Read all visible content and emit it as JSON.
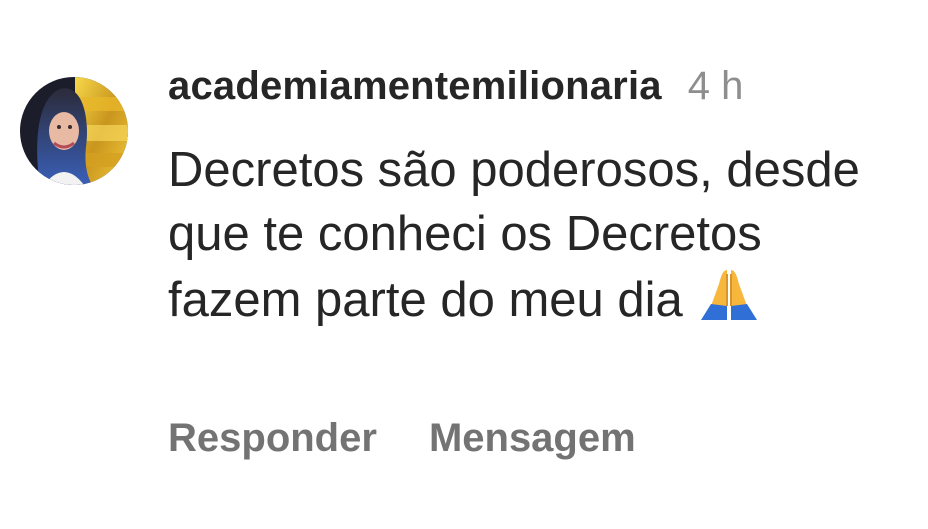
{
  "comment": {
    "avatar_icon": "profile-avatar",
    "username": "academiamentemilionaria",
    "timestamp": "4 h",
    "text": "Decretos são poderosos, desde que te conheci os Decretos fazem parte do meu dia",
    "emoji_icon": "praying-hands-icon"
  },
  "actions": {
    "reply_label": "Responder",
    "message_label": "Mensagem"
  },
  "colors": {
    "text": "#262626",
    "muted": "#8e8e8e",
    "action": "#737373"
  }
}
